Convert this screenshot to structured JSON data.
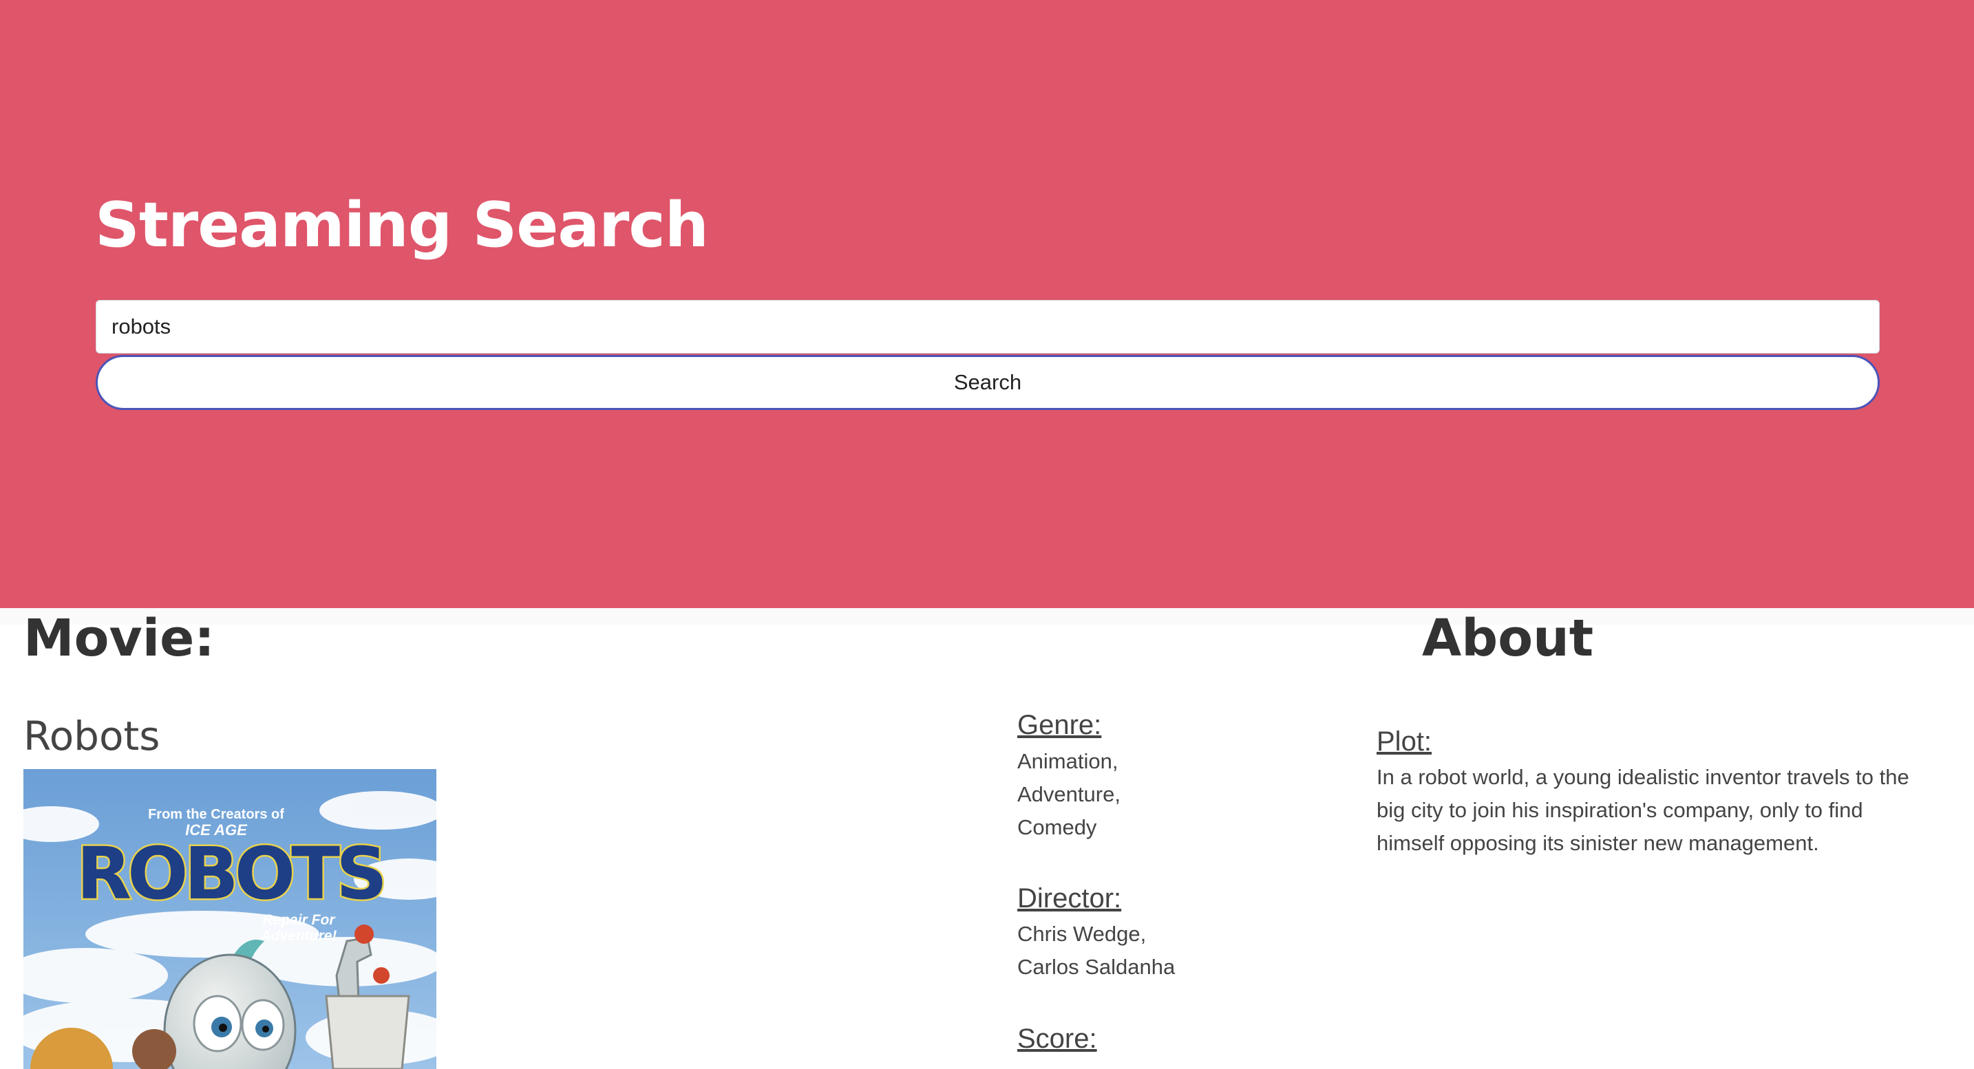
{
  "header": {
    "title": "Streaming Search",
    "search_value": "robots",
    "search_button_label": "Search"
  },
  "movie_section": {
    "heading": "Movie:",
    "title": "Robots",
    "poster": {
      "tagline_top": "From the Creators of",
      "tagline_ice": "ICE AGE",
      "logo": "ROBOTS",
      "tagline_bottom_1": "Repair For",
      "tagline_bottom_2": "Adventure!"
    },
    "genre_label": "Genre:",
    "genres": [
      "Animation,",
      "Adventure,",
      "Comedy"
    ],
    "director_label": "Director:",
    "directors": [
      "Chris Wedge,",
      "Carlos Saldanha"
    ],
    "score_label": "Score:"
  },
  "about_section": {
    "heading": "About",
    "plot_label": "Plot:",
    "plot_lines": [
      "In a robot world, a young idealistic inventor travels to the",
      "big city to join his inspiration's company, only to find",
      "himself opposing its sinister new management."
    ]
  },
  "colors": {
    "hero_background": "#df556a",
    "button_border": "#4954b8"
  }
}
